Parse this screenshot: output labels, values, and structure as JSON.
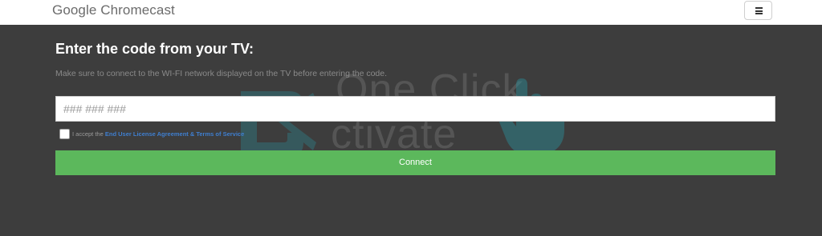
{
  "header": {
    "brand": "Google Chromecast",
    "menu_icon": "hamburger-menu-icon"
  },
  "main": {
    "heading": "Enter the code from your TV:",
    "note": "Make sure to connect to the WI-FI network displayed on the TV before entering the code.",
    "code_input": {
      "placeholder": "### ### ###",
      "value": ""
    },
    "accept": {
      "checked": false,
      "prefix": "I accept the ",
      "link_text": "End User License Agreement & Terms of Service"
    },
    "connect_label": "Connect"
  },
  "watermark": {
    "line1": "One Click",
    "line2": "ctivate",
    "icon": "one-click-activate-logo-icon",
    "hand_icon": "pointing-hand-icon"
  },
  "colors": {
    "background": "#3d3d3d",
    "header": "#ffffff",
    "connect": "#5cb85c",
    "link": "#3f7fd0",
    "watermark_teal": "#2a8f9a"
  }
}
